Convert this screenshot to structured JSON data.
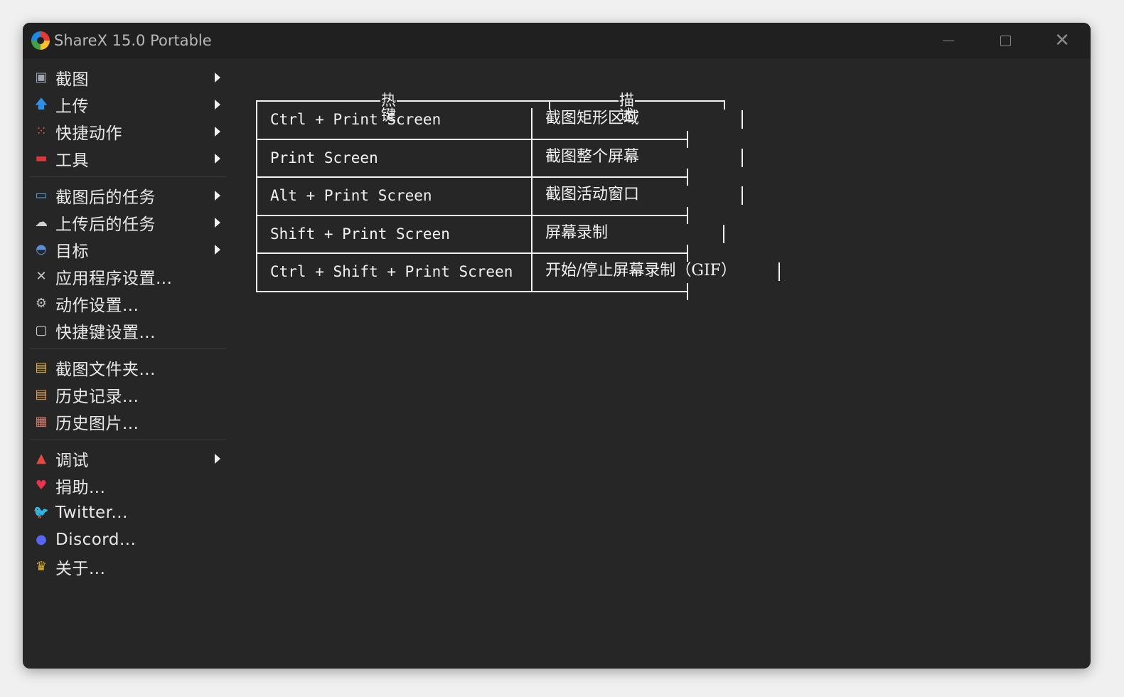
{
  "window": {
    "title": "ShareX 15.0 Portable"
  },
  "menu": {
    "groups": [
      [
        {
          "icon": "screenshot-icon",
          "label": "截图",
          "submenu": true
        },
        {
          "icon": "upload-arrow-icon",
          "label": "上传",
          "submenu": true
        },
        {
          "icon": "dots-grid-icon",
          "label": "快捷动作",
          "submenu": true
        },
        {
          "icon": "toolbox-icon",
          "label": "工具",
          "submenu": true
        }
      ],
      [
        {
          "icon": "after-capture-icon",
          "label": "截图后的任务",
          "submenu": true
        },
        {
          "icon": "cloud-upload-icon",
          "label": "上传后的任务",
          "submenu": true
        },
        {
          "icon": "destination-icon",
          "label": "目标",
          "submenu": true
        },
        {
          "icon": "wrench-icon",
          "label": "应用程序设置...",
          "submenu": false
        },
        {
          "icon": "gear-icon",
          "label": "动作设置...",
          "submenu": false
        },
        {
          "icon": "keyboard-icon",
          "label": "快捷键设置...",
          "submenu": false
        }
      ],
      [
        {
          "icon": "folder-icon",
          "label": "截图文件夹...",
          "submenu": false
        },
        {
          "icon": "history-icon",
          "label": "历史记录...",
          "submenu": false
        },
        {
          "icon": "image-history-icon",
          "label": "历史图片...",
          "submenu": false
        }
      ],
      [
        {
          "icon": "debug-cone-icon",
          "label": "调试",
          "submenu": true
        },
        {
          "icon": "heart-icon",
          "label": "捐助...",
          "submenu": false
        },
        {
          "icon": "twitter-bird-icon",
          "label": "Twitter...",
          "submenu": false
        },
        {
          "icon": "discord-icon",
          "label": "Discord...",
          "submenu": false
        },
        {
          "icon": "crown-icon",
          "label": "关于...",
          "submenu": false
        }
      ]
    ]
  },
  "hotkey_table": {
    "headers": {
      "hotkey": "热键",
      "description": "描述"
    },
    "rows": [
      {
        "hotkey": "Ctrl + Print Screen",
        "description": "截图矩形区域"
      },
      {
        "hotkey": "Print Screen",
        "description": "截图整个屏幕"
      },
      {
        "hotkey": "Alt + Print Screen",
        "description": "截图活动窗口"
      },
      {
        "hotkey": "Shift + Print Screen",
        "description": "屏幕录制"
      },
      {
        "hotkey": "Ctrl + Shift + Print Screen",
        "description": "开始/停止屏幕录制（GIF）"
      }
    ]
  }
}
